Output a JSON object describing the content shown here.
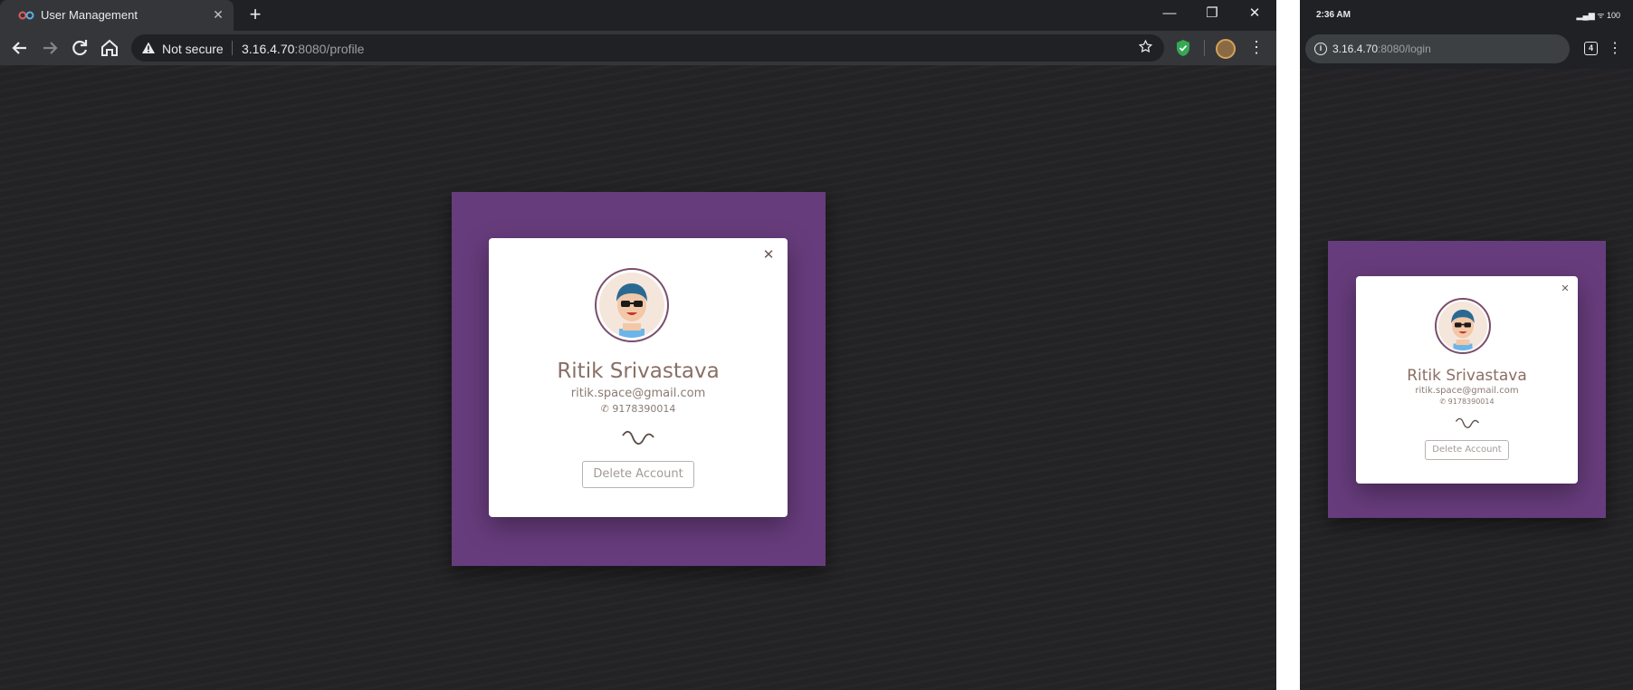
{
  "browser": {
    "tab_title": "User Management",
    "tab_close": "✕",
    "new_tab": "+",
    "window_controls": {
      "minimize": "—",
      "restore": "❐",
      "close": "✕"
    },
    "not_secure": "Not secure",
    "url_host": "3.16.4.70",
    "url_path": ":8080/profile",
    "icons": [
      "back-arrow-icon",
      "forward-arrow-icon",
      "reload-icon",
      "home-icon",
      "warning-icon",
      "star-icon",
      "shield-extension-icon",
      "avatar-icon",
      "menu-dots-icon"
    ]
  },
  "profile_card": {
    "close_glyph": "✕",
    "name": "Ritik Srivastava",
    "email": "ritik.space@gmail.com",
    "phone_icon": "✆",
    "phone": "9178390014",
    "delete_label": "Delete Account",
    "accent_color": "#673c7c"
  },
  "mobile": {
    "time": "2:36 AM",
    "status_icons": "▂▄▆ ᯤ 100",
    "url_host": "3.16.4.70",
    "url_path": ":8080/login",
    "tab_count": "4",
    "info_glyph": "i",
    "menu_glyph": "⋮",
    "card": {
      "close_glyph": "✕",
      "name": "Ritik Srivastava",
      "email": "ritik.space@gmail.com",
      "phone_icon": "✆",
      "phone": "9178390014",
      "delete_label": "Delete Account"
    }
  }
}
